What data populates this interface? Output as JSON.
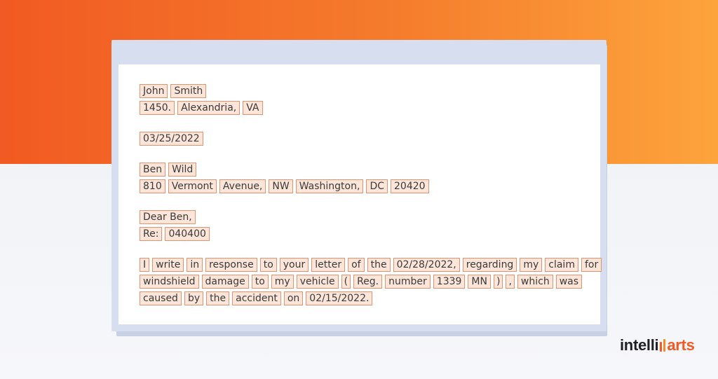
{
  "letter": {
    "lines": [
      [
        "John",
        "Smith"
      ],
      [
        "1450.",
        "Alexandria,",
        "VA"
      ],
      [
        "03/25/2022"
      ],
      [
        "Ben",
        "Wild"
      ],
      [
        "810",
        "Vermont",
        "Avenue,",
        "NW",
        "Washington,",
        "DC",
        "20420"
      ],
      [
        "Dear Ben,"
      ],
      [
        "Re:",
        "040400"
      ],
      [
        "I",
        "write",
        "in",
        "response",
        "to",
        "your",
        "letter",
        "of",
        "the",
        "02/28/2022,",
        "regarding",
        "my",
        "claim",
        "for"
      ],
      [
        "windshield",
        "damage",
        "to",
        "my",
        "vehicle",
        "(",
        "Reg.",
        "number",
        "1339",
        "MN",
        ")",
        ",",
        "which",
        "was"
      ],
      [
        "caused",
        "by",
        "the",
        "accident",
        "on",
        "02/15/2022."
      ]
    ]
  },
  "brand": {
    "logo_prefix": "intelli",
    "logo_suffix": "arts",
    "colors": {
      "orange": "#f15a22",
      "orange_light": "#fda43c",
      "token_bg": "#fde6d9",
      "token_border": "#e0936f"
    }
  }
}
